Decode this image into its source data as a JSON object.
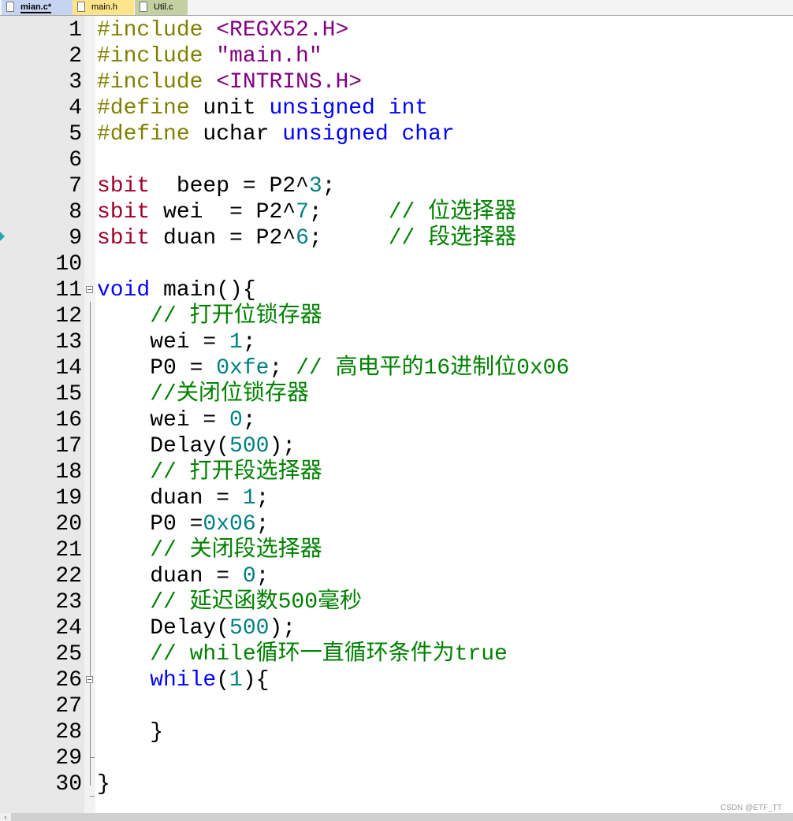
{
  "tabs": [
    {
      "label": "mian.c*",
      "active": true
    },
    {
      "label": "main.h"
    },
    {
      "label": "Util.c"
    }
  ],
  "colors": {
    "preprocessor": "#808000",
    "string": "#800080",
    "keyword": "#0000ff",
    "sbit": "#a0002a",
    "number": "#008080",
    "comment": "#008000"
  },
  "lines": [
    [
      [
        "#include ",
        "pp"
      ],
      [
        "<REGX52.H>",
        "str"
      ]
    ],
    [
      [
        "#include ",
        "pp"
      ],
      [
        "\"main.h\"",
        "str"
      ]
    ],
    [
      [
        "#include ",
        "pp"
      ],
      [
        "<INTRINS.H>",
        "str"
      ]
    ],
    [
      [
        "#define ",
        "pp"
      ],
      [
        "unit ",
        "tx"
      ],
      [
        "unsigned int",
        "kw"
      ]
    ],
    [
      [
        "#define ",
        "pp"
      ],
      [
        "uchar ",
        "tx"
      ],
      [
        "unsigned char",
        "kw"
      ]
    ],
    [],
    [
      [
        "sbit",
        "sb"
      ],
      [
        "  beep = P2^",
        "tx"
      ],
      [
        "3",
        "num"
      ],
      [
        ";",
        "tx"
      ]
    ],
    [
      [
        "sbit",
        "sb"
      ],
      [
        " wei  = P2^",
        "tx"
      ],
      [
        "7",
        "num"
      ],
      [
        ";     ",
        "tx"
      ],
      [
        "// 位选择器",
        "cm"
      ]
    ],
    [
      [
        "sbit",
        "sb"
      ],
      [
        " duan = P2^",
        "tx"
      ],
      [
        "6",
        "num"
      ],
      [
        ";     ",
        "tx"
      ],
      [
        "// 段选择器",
        "cm"
      ]
    ],
    [],
    [
      [
        "void",
        "kw"
      ],
      [
        " main(){",
        "tx"
      ]
    ],
    [
      [
        "    ",
        "tx"
      ],
      [
        "// 打开位锁存器",
        "cm"
      ]
    ],
    [
      [
        "    wei = ",
        "tx"
      ],
      [
        "1",
        "num"
      ],
      [
        ";",
        "tx"
      ]
    ],
    [
      [
        "    P0 = ",
        "tx"
      ],
      [
        "0xfe",
        "num"
      ],
      [
        "; ",
        "tx"
      ],
      [
        "// 高电平的16进制位0x06",
        "cm"
      ]
    ],
    [
      [
        "    ",
        "tx"
      ],
      [
        "//关闭位锁存器",
        "cm"
      ]
    ],
    [
      [
        "    wei = ",
        "tx"
      ],
      [
        "0",
        "num"
      ],
      [
        ";",
        "tx"
      ]
    ],
    [
      [
        "    Delay(",
        "tx"
      ],
      [
        "500",
        "num"
      ],
      [
        ");",
        "tx"
      ]
    ],
    [
      [
        "    ",
        "tx"
      ],
      [
        "// 打开段选择器",
        "cm"
      ]
    ],
    [
      [
        "    duan = ",
        "tx"
      ],
      [
        "1",
        "num"
      ],
      [
        ";",
        "tx"
      ]
    ],
    [
      [
        "    P0 =",
        "tx"
      ],
      [
        "0x06",
        "num"
      ],
      [
        ";",
        "tx"
      ]
    ],
    [
      [
        "    ",
        "tx"
      ],
      [
        "// 关闭段选择器",
        "cm"
      ]
    ],
    [
      [
        "    duan = ",
        "tx"
      ],
      [
        "0",
        "num"
      ],
      [
        ";",
        "tx"
      ]
    ],
    [
      [
        "    ",
        "tx"
      ],
      [
        "// 延迟函数500毫秒",
        "cm"
      ]
    ],
    [
      [
        "    Delay(",
        "tx"
      ],
      [
        "500",
        "num"
      ],
      [
        ");",
        "tx"
      ]
    ],
    [
      [
        "    ",
        "tx"
      ],
      [
        "// while循环一直循环条件为true",
        "cm"
      ]
    ],
    [
      [
        "    ",
        "tx"
      ],
      [
        "while",
        "kw"
      ],
      [
        "(",
        "tx"
      ],
      [
        "1",
        "num"
      ],
      [
        "){",
        "tx"
      ]
    ],
    [],
    [
      [
        "    }",
        "tx"
      ]
    ],
    [],
    [
      [
        "}",
        "tx"
      ]
    ]
  ],
  "watermark": "CSDN @ETF_TT"
}
